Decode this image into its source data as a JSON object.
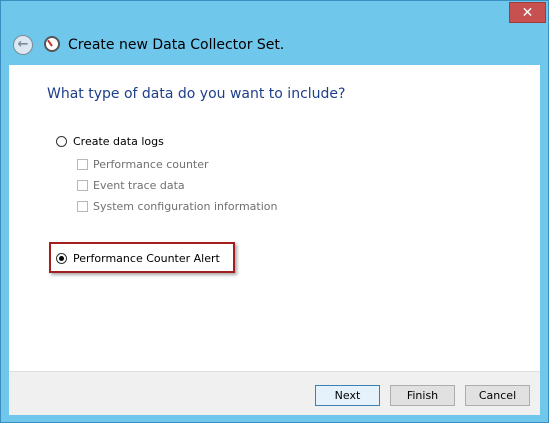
{
  "window": {
    "close_glyph": "✕",
    "title": "Create new Data Collector Set.",
    "back_glyph": "←"
  },
  "main": {
    "heading": "What type of data do you want to include?",
    "options": [
      {
        "label": "Create data logs",
        "selected": false
      },
      {
        "label": "Performance Counter Alert",
        "selected": true
      }
    ],
    "data_logs_items": [
      {
        "label": "Performance counter",
        "checked": false,
        "enabled": false
      },
      {
        "label": "Event trace data",
        "checked": false,
        "enabled": false
      },
      {
        "label": "System configuration information",
        "checked": false,
        "enabled": false
      }
    ]
  },
  "footer": {
    "next_label": "Next",
    "finish_label": "Finish",
    "cancel_label": "Cancel"
  },
  "colors": {
    "frame": "#6fc7ec",
    "heading": "#1e3f8a",
    "close_button": "#c75050",
    "highlight": "#a31f1f"
  },
  "icons": {
    "back": "back-arrow-icon",
    "app": "performance-monitor-icon",
    "close": "close-icon"
  }
}
